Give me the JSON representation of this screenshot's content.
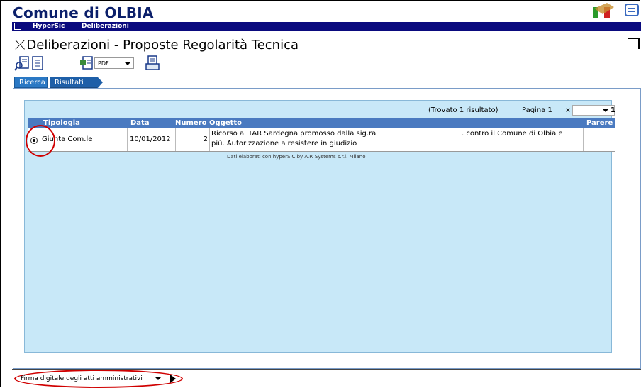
{
  "app": {
    "title": "Comune di OLBIA",
    "menu": [
      "HyperSic",
      "Deliberazioni"
    ]
  },
  "page": {
    "heading": "Deliberazioni - Proposte Regolarità Tecnica"
  },
  "toolbar": {
    "export_format": "PDF"
  },
  "tabs": [
    {
      "label": "Ricerca"
    },
    {
      "label": "Risultati"
    }
  ],
  "results": {
    "found_text": "(Trovato 1 risultato)",
    "page_label": "Pagina 1",
    "page_x": "x",
    "page_total": "1",
    "columns": [
      "Tipologia",
      "Data",
      "Numero",
      "Oggetto",
      "Parere"
    ],
    "rows": [
      {
        "tipologia": "Giunta Com.le",
        "data": "10/01/2012",
        "numero": "2",
        "oggetto_line1_a": "Ricorso al TAR Sardegna promosso dalla sig.ra",
        "oggetto_line1_b": ". contro il Comune di Olbia e",
        "oggetto_line2": "più. Autorizzazione a resistere in giudizio",
        "parere": ""
      }
    ],
    "credit": "Dati elaborati con hyperSIC by A.P. Systems s.r.l. Milano"
  },
  "footer": {
    "action_select": "Firma digitale degli atti amministrativi"
  },
  "colors": {
    "topbar": "#0a0a7e",
    "panel": "#c8e8f8",
    "header_row": "#4a7ac0",
    "annotation": "#d00000"
  }
}
